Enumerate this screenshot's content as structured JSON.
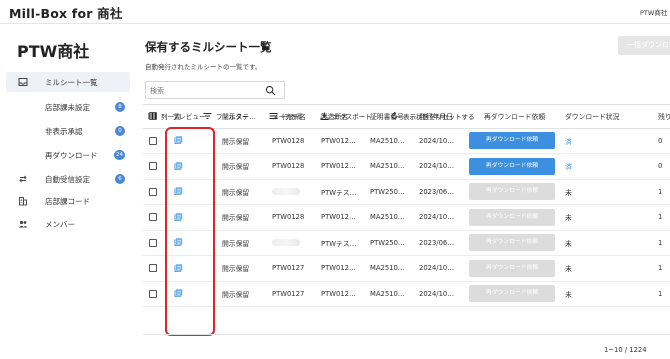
{
  "header": {
    "app_title": "Mill-Box for 商社",
    "company_short": "PTW商社"
  },
  "sidebar": {
    "company": "PTW商社",
    "items": [
      {
        "label": "ミルシート一覧",
        "icon": "inbox-icon",
        "active": true
      },
      {
        "label": "店部課未設定",
        "badge": "8",
        "sub": true
      },
      {
        "label": "非表示承認",
        "badge": "0",
        "sub": true
      },
      {
        "label": "再ダウンロード",
        "badge": "24",
        "sub": true
      },
      {
        "label": "自動受信設定",
        "icon": "swap-icon",
        "badge": "6"
      },
      {
        "label": "店部課コード",
        "icon": "building-icon"
      },
      {
        "label": "メンバー",
        "icon": "people-icon"
      }
    ]
  },
  "main": {
    "title": "保有するミルシート一覧",
    "subtitle": "自動発行されたミルシートの一覧です。",
    "top_button": "一括ダウンロード",
    "search": {
      "placeholder": "検索"
    },
    "toolbar": {
      "columns": "列一覧",
      "filter": "フィルター",
      "density": "行間隔",
      "export": "エクスポート",
      "reset": "表示状態をリセットする"
    },
    "table": {
      "headers": [
        "",
        "プレビュー",
        "開示ステ…",
        "メーカー名",
        "製造所名",
        "証明書番号",
        "発行年月日",
        "再ダウンロード依頼",
        "ダウンロード状況",
        "残り"
      ],
      "button_label": "再ダウンロード依頼",
      "rows": [
        {
          "status": "開示保留",
          "maker": "PTW0128",
          "maker_blur": false,
          "plant": "PTW012…",
          "cert": "MA2510…",
          "date": "2024/10…",
          "btn_active": true,
          "dl": "済",
          "rest": "0"
        },
        {
          "status": "開示保留",
          "maker": "PTW0128",
          "maker_blur": false,
          "plant": "PTW012…",
          "cert": "MA2510…",
          "date": "2024/10…",
          "btn_active": true,
          "dl": "済",
          "rest": "0"
        },
        {
          "status": "開示保留",
          "maker": "",
          "maker_blur": true,
          "plant": "PTWテス…",
          "cert": "PTW250…",
          "date": "2023/06…",
          "btn_active": false,
          "dl": "未",
          "rest": "1"
        },
        {
          "status": "開示保留",
          "maker": "PTW0128",
          "maker_blur": false,
          "plant": "PTW012…",
          "cert": "MA2510…",
          "date": "2024/10…",
          "btn_active": false,
          "dl": "未",
          "rest": "1"
        },
        {
          "status": "開示保留",
          "maker": "",
          "maker_blur": true,
          "plant": "PTWテス…",
          "cert": "PTW250…",
          "date": "2023/06…",
          "btn_active": false,
          "dl": "未",
          "rest": "1"
        },
        {
          "status": "開示保留",
          "maker": "PTW0127",
          "maker_blur": false,
          "plant": "PTW012…",
          "cert": "MA2510…",
          "date": "2024/10…",
          "btn_active": false,
          "dl": "未",
          "rest": "1"
        },
        {
          "status": "開示保留",
          "maker": "PTW0127",
          "maker_blur": false,
          "plant": "PTW012…",
          "cert": "MA2510…",
          "date": "2024/10…",
          "btn_active": false,
          "dl": "未",
          "rest": "1"
        }
      ]
    },
    "pagination": "1~10 / 1224"
  },
  "colors": {
    "accent": "#3d8fe0",
    "badge": "#4b88d6",
    "highlight": "#e0262c"
  }
}
